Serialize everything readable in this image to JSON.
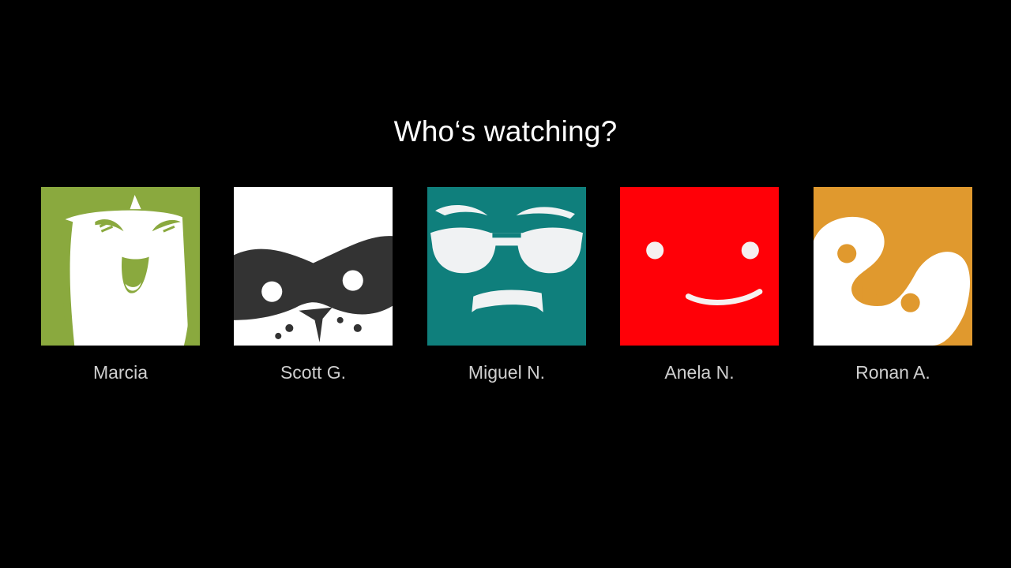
{
  "page": {
    "heading": "Who‘s watching?"
  },
  "profiles": [
    {
      "name": "Marcia",
      "avatar_icon": "green-laughing-face-icon",
      "color": "#8aa93e"
    },
    {
      "name": "Scott G.",
      "avatar_icon": "raccoon-mask-face-icon",
      "color": "#ffffff"
    },
    {
      "name": "Miguel N.",
      "avatar_icon": "sunglasses-face-icon",
      "color": "#0f7f7c"
    },
    {
      "name": "Anela N.",
      "avatar_icon": "red-smile-face-icon",
      "color": "#ff0007"
    },
    {
      "name": "Ronan A.",
      "avatar_icon": "penguin-face-icon",
      "color": "#e0992e"
    }
  ]
}
